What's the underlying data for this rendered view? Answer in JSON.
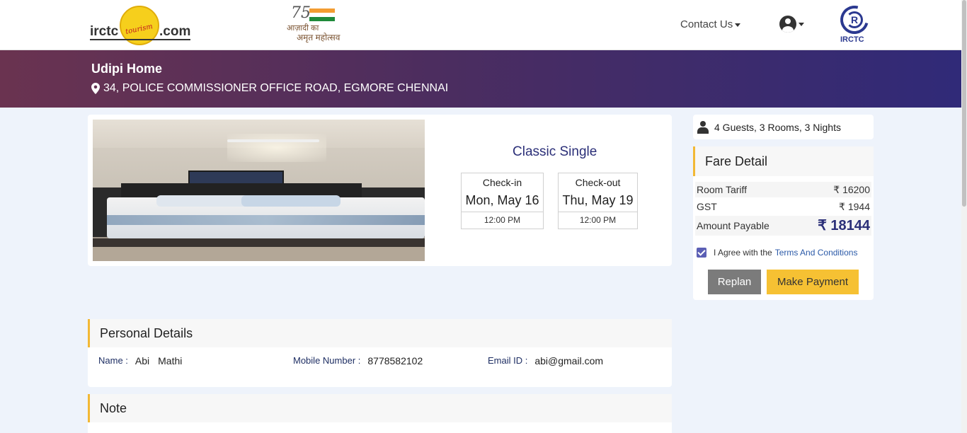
{
  "header": {
    "logo_left": "irctc",
    "logo_right": ".com",
    "logo_script": "tourism",
    "azadi_number": "75",
    "azadi_line1": "आज़ादी का",
    "azadi_line2": "अमृत महोत्सव",
    "contact_label": "Contact Us",
    "irctc_caption": "IRCTC"
  },
  "hotel": {
    "name": "Udipi Home",
    "address": "34, POLICE COMMISSIONER OFFICE ROAD, EGMORE CHENNAI"
  },
  "room": {
    "type": "Classic Single",
    "checkin_label": "Check-in",
    "checkin_date": "Mon, May 16",
    "checkin_time": "12:00 PM",
    "checkout_label": "Check-out",
    "checkout_date": "Thu, May 19",
    "checkout_time": "12:00 PM"
  },
  "summary": {
    "guests": "4 Guests, 3 Rooms, 3 Nights"
  },
  "fare": {
    "title": "Fare Detail",
    "rows": [
      {
        "label": "Room Tariff",
        "value": "₹ 16200"
      },
      {
        "label": "GST",
        "value": "₹ 1944"
      },
      {
        "label": "Amount Payable",
        "value": "₹ 18144"
      }
    ],
    "agree_text": "I Agree with the",
    "terms_link": "Terms And Conditions",
    "agree_checked": true,
    "replan_label": "Replan",
    "pay_label": "Make Payment"
  },
  "personal": {
    "title": "Personal Details",
    "name_label": "Name :",
    "first_name": "Abi",
    "last_name": "Mathi",
    "mobile_label": "Mobile Number :",
    "mobile": "8778582102",
    "email_label": "Email ID :",
    "email": "abi@gmail.com"
  },
  "note": {
    "title": "Note"
  },
  "colors": {
    "accent": "#2b2f78",
    "banner_start": "#6a3350",
    "banner_end": "#302a78",
    "pay_button": "#f6c133",
    "section_bar": "#f2b835"
  }
}
